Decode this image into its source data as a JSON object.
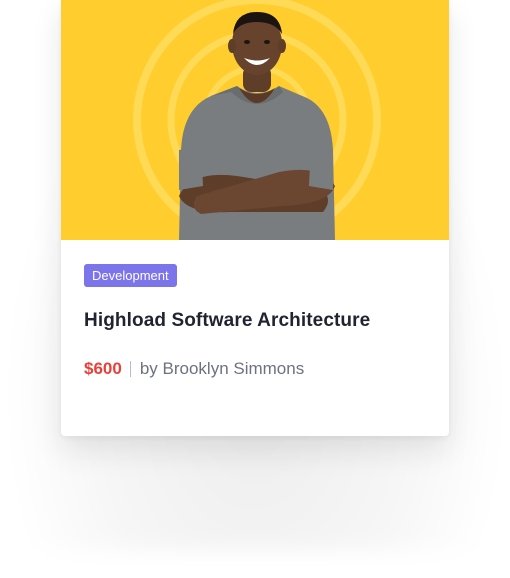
{
  "course": {
    "category": "Development",
    "title": "Highload Software Architecture",
    "price": "$600",
    "byline": "by Brooklyn Simmons",
    "image_alt": "Smiling instructor in grey t-shirt with arms crossed",
    "colors": {
      "cover_background": "#ffce2e",
      "badge": "#7b74ea",
      "price": "#e8413a",
      "title": "#1f2430",
      "byline": "#6d7280"
    }
  }
}
